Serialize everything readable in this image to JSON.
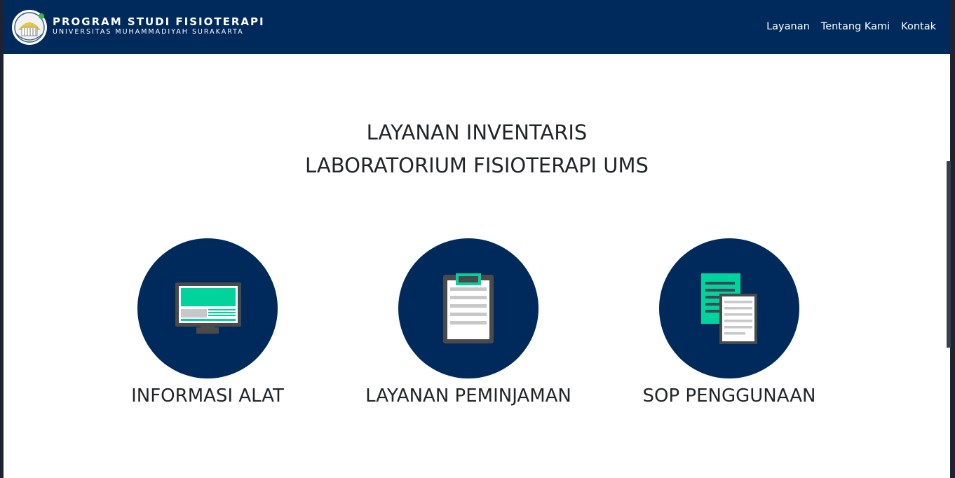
{
  "header": {
    "brand_title": "PROGRAM STUDI FISIOTERAPI",
    "brand_subtitle": "UNIVERSITAS MUHAMMADIYAH SURAKARTA",
    "logo_text": "FISIOTERAPI",
    "nav": [
      {
        "label": "Layanan"
      },
      {
        "label": "Tentang Kami"
      },
      {
        "label": "Kontak"
      }
    ]
  },
  "main": {
    "title_line1": "LAYANAN INVENTARIS",
    "title_line2": "LABORATORIUM FISIOTERAPI UMS",
    "cards": [
      {
        "label": "INFORMASI ALAT",
        "icon": "monitor-icon"
      },
      {
        "label": "LAYANAN PEMINJAMAN",
        "icon": "clipboard-icon"
      },
      {
        "label": "SOP PENGGUNAAN",
        "icon": "documents-icon"
      }
    ]
  },
  "colors": {
    "navbar": "#002a5c",
    "circle": "#002a5c",
    "accent": "#00d39c",
    "text": "#212529"
  }
}
